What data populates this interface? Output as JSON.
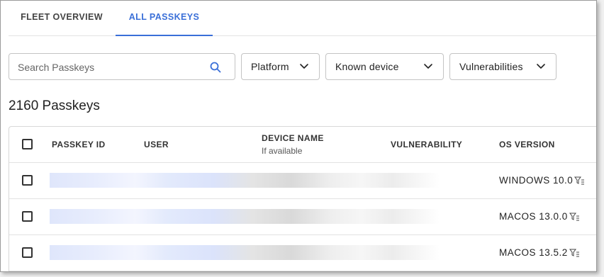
{
  "tabs": [
    {
      "label": "FLEET OVERVIEW",
      "active": false
    },
    {
      "label": "ALL PASSKEYS",
      "active": true
    }
  ],
  "search": {
    "placeholder": "Search Passkeys",
    "value": "",
    "icon": "search-icon"
  },
  "filters": {
    "platform": "Platform",
    "known_device": "Known device",
    "vulnerabilities": "Vulnerabilities"
  },
  "count_label": "2160 Passkeys",
  "table": {
    "columns": {
      "passkey_id": "PASSKEY ID",
      "user": "USER",
      "device_name": "DEVICE NAME",
      "device_name_sub": "If available",
      "vulnerability": "VULNERABILITY",
      "os_version": "OS VERSION"
    },
    "rows": [
      {
        "os_version": "WINDOWS 10.0"
      },
      {
        "os_version": "MACOS 13.0.0"
      },
      {
        "os_version": "MACOS 13.5.2"
      }
    ]
  },
  "colors": {
    "accent": "#3a6fd8",
    "border": "#c4c4c4",
    "text": "#222222"
  }
}
